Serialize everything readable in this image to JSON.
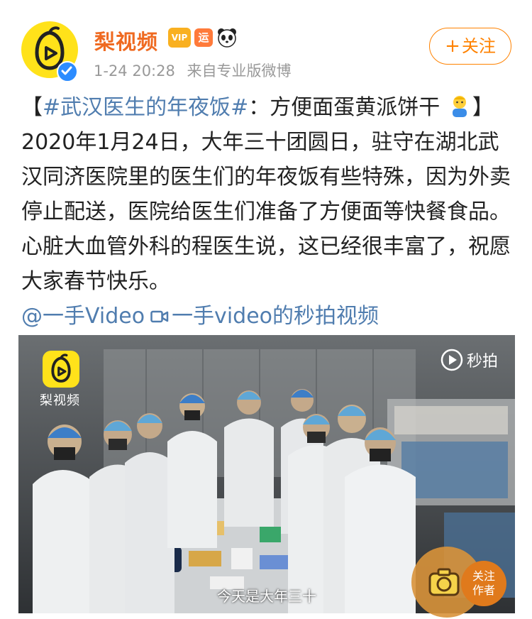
{
  "account": {
    "name": "梨视频",
    "badge_vip": "VIP",
    "badge_yun": "运",
    "timestamp": "1-24 20:28",
    "source": "来自专业版微博",
    "follow_label": "关注",
    "follow_plus": "+"
  },
  "post": {
    "bracket_open": "【",
    "hashtag": "#武汉医生的年夜饭#",
    "headline_rest": "：方便面蛋黄派饼干",
    "bracket_close": "】",
    "body": "2020年1月24日，大年三十团圆日，驻守在湖北武汉同济医院里的医生们的年夜饭有些特殊，因为外卖停止配送，医院给医生们准备了方便面等快餐食品。心脏大血管外科的程医生说，这已经很丰富了，祝愿大家春节快乐。",
    "mention": "@一手Video",
    "video_link": "一手video的秒拍视频"
  },
  "video": {
    "watermark_label": "梨视频",
    "platform_label": "秒拍",
    "subtitle": "今天是大年三十"
  },
  "follow_author": {
    "line1": "关注",
    "line2": "作者"
  },
  "colors": {
    "brand_orange": "#ef6a21",
    "link_blue": "#507daf",
    "follow_orange": "#ff8200",
    "pear_yellow": "#ffe21a"
  }
}
